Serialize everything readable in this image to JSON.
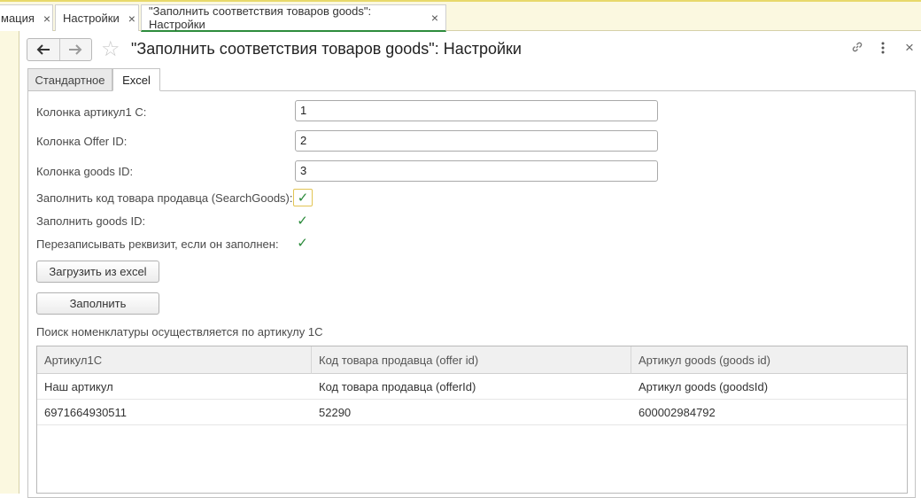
{
  "window_tabs": [
    {
      "label": "мация"
    },
    {
      "label": "Настройки"
    },
    {
      "label": "\"Заполнить соответствия товаров goods\": Настройки"
    }
  ],
  "icons": {
    "close": "×",
    "back": "arrow-left",
    "forward": "arrow-right",
    "favorite": "star",
    "link": "link",
    "more": "more-vertical",
    "check": "✓"
  },
  "header": {
    "title": "\"Заполнить соответствия товаров goods\": Настройки"
  },
  "form_tabs": [
    {
      "label": "Стандартное"
    },
    {
      "label": "Excel"
    }
  ],
  "fields": {
    "article_1c": {
      "label": "Колонка артикул1 С:",
      "value": "1"
    },
    "offer_id": {
      "label": "Колонка Offer ID:",
      "value": "2"
    },
    "goods_id": {
      "label": "Колонка goods ID:",
      "value": "3"
    }
  },
  "checkboxes": {
    "search_goods": {
      "label": "Заполнить код товара продавца (SearchGoods):",
      "checked": true
    },
    "fill_goods_id": {
      "label": "Заполнить goods ID:",
      "checked": true
    },
    "overwrite": {
      "label": "Перезаписывать реквизит, если он заполнен:",
      "checked": true
    }
  },
  "buttons": {
    "load_excel": "Загрузить из excel",
    "fill": "Заполнить"
  },
  "info_text": "Поиск номенклатуры осуществляется по артикулу 1С",
  "table": {
    "columns": [
      "Артикул1С",
      "Код товара продавца (offer id)",
      "Артикул goods (goods id)"
    ],
    "rows": [
      [
        "Наш артикул",
        "Код товара продавца (offerId)",
        "Артикул goods (goodsId)"
      ],
      [
        "6971664930511",
        "52290",
        "600002984792"
      ]
    ]
  },
  "colors": {
    "accent": "#2d8c3c",
    "tabbar_bg": "#fbf8e0",
    "focus_border": "#e2c454"
  }
}
